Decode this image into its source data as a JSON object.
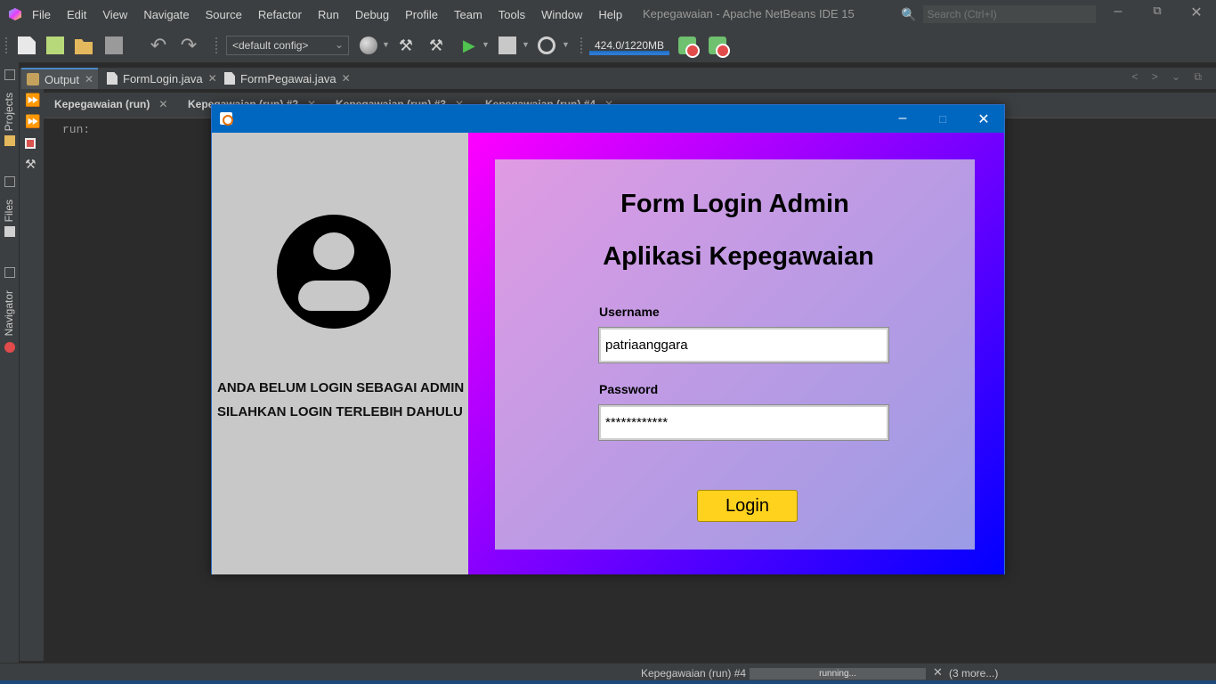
{
  "ide": {
    "menu": [
      "File",
      "Edit",
      "View",
      "Navigate",
      "Source",
      "Refactor",
      "Run",
      "Debug",
      "Profile",
      "Team",
      "Tools",
      "Window",
      "Help"
    ],
    "title": "Kepegawaian - Apache NetBeans IDE 15",
    "search_placeholder": "Search (Ctrl+I)",
    "config": "<default config>",
    "memory": "424.0/1220MB",
    "side_tabs": [
      "Projects",
      "Files",
      "Navigator"
    ],
    "editor_tabs": [
      "Output",
      "FormLogin.java",
      "FormPegawai.java"
    ],
    "run_tabs": [
      "Kepegawaian (run)",
      "Kepegawaian (run) #2",
      "Kepegawaian (run) #3",
      "Kepegawaian (run) #4"
    ],
    "console_line": "run:",
    "status": {
      "task": "Kepegawaian (run) #4",
      "progress_text": "running...",
      "more": "(3 more...)"
    }
  },
  "app": {
    "message_line1": "ANDA BELUM LOGIN SEBAGAI ADMIN",
    "message_line2": "SILAHKAN LOGIN TERLEBIH DAHULU",
    "title1": "Form Login Admin",
    "title2": "Aplikasi Kepegawaian",
    "username_label": "Username",
    "username_value": "patriaanggara",
    "password_label": "Password",
    "password_value": "************",
    "login_label": "Login"
  },
  "colors": {
    "gradient_start": "#ff00ff",
    "gradient_end": "#0000ff",
    "login_button": "#ffd21e",
    "left_panel": "#c8c8c8",
    "titlebar": "#0067c0"
  }
}
